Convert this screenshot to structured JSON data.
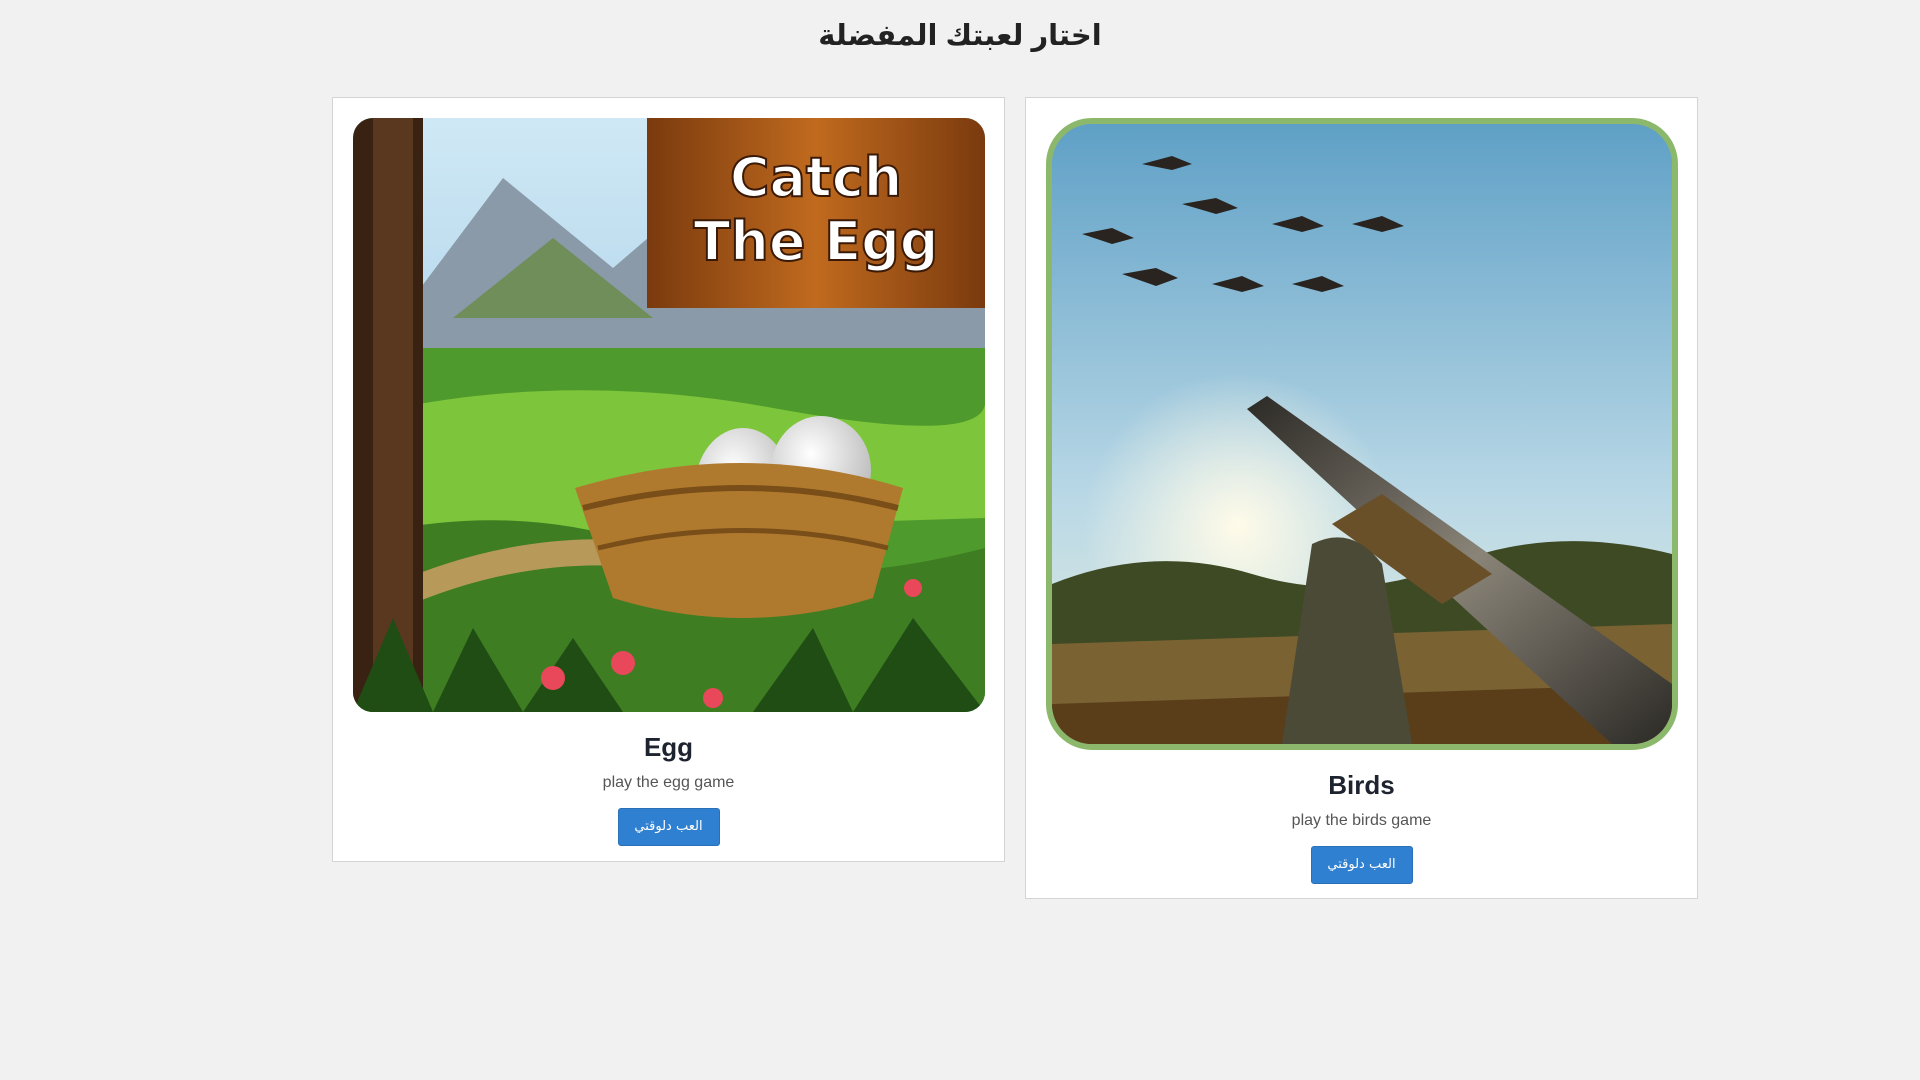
{
  "page": {
    "title": "اختار لعبتك المفضلة"
  },
  "colors": {
    "background": "#f1f1f1",
    "card": "#ffffff",
    "button": "#2f80d0",
    "birds_frame": "#8bb86a"
  },
  "games": [
    {
      "name": "Egg",
      "description": "play the egg game",
      "button_label": "العب دلوقتي",
      "image_sign_lines": [
        "Catch",
        "The Egg"
      ]
    },
    {
      "name": "Birds",
      "description": "play the birds game",
      "button_label": "العب دلوقتي"
    }
  ]
}
